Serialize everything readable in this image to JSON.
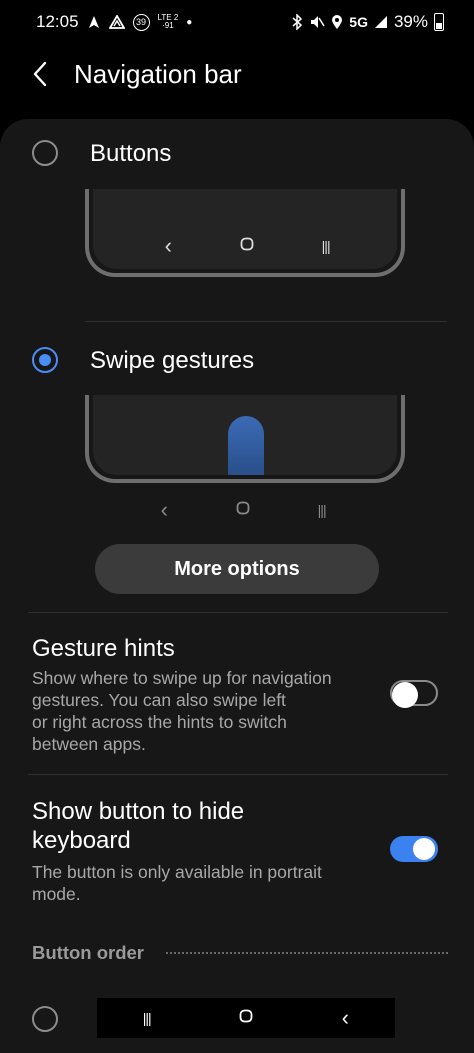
{
  "status_bar": {
    "time": "12:05",
    "notif_badge": "39",
    "lte_top": "LTE 2",
    "lte_bottom": "·91",
    "network": "5G",
    "battery": "39%"
  },
  "header": {
    "title": "Navigation bar"
  },
  "options": {
    "buttons": {
      "label": "Buttons",
      "selected": false
    },
    "swipe": {
      "label": "Swipe gestures",
      "selected": true
    }
  },
  "nav_keys": {
    "back": "‹",
    "home": "◯",
    "recents": "|||"
  },
  "more_options": {
    "label": "More options"
  },
  "gesture_hints": {
    "title": "Gesture hints",
    "desc_lines": [
      "Show where to swipe up for navigation",
      "gestures. You can also swipe left",
      "or right across the hints to switch",
      "between apps."
    ],
    "enabled": false
  },
  "hide_keyboard": {
    "title_lines": [
      "Show button to hide",
      "keyboard"
    ],
    "desc_lines": [
      "The button is only available in portrait",
      "mode."
    ],
    "enabled": true
  },
  "button_order": {
    "header": "Button order"
  },
  "colors": {
    "accent": "#4a8ef5",
    "toggle_on": "#3b82f0",
    "card_bg": "#171717"
  }
}
